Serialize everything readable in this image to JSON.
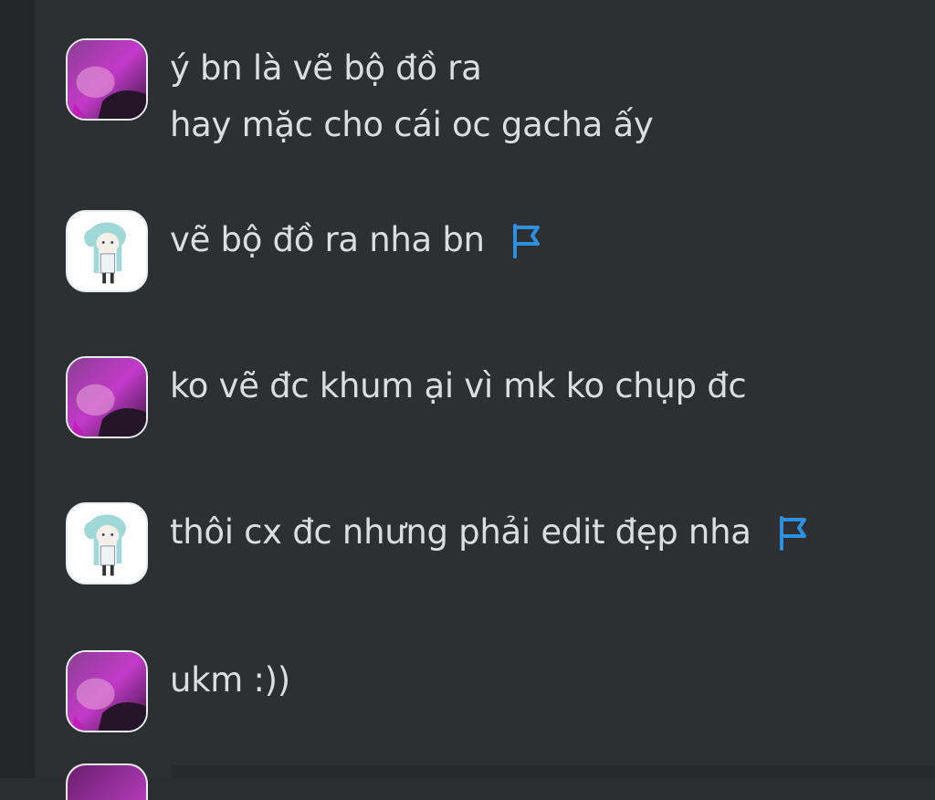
{
  "messages": [
    {
      "author": "purple",
      "lines": [
        "ý bn là vẽ bộ đồ ra",
        "hay mặc cho cái oc gacha ấy"
      ],
      "flagged": false
    },
    {
      "author": "gacha",
      "lines": [
        "vẽ bộ đồ ra nha bn"
      ],
      "flagged": true
    },
    {
      "author": "purple",
      "lines": [
        "ko vẽ đc khum ại vì mk ko chụp đc"
      ],
      "flagged": false
    },
    {
      "author": "gacha",
      "lines": [
        "thôi cx đc nhưng phải edit đẹp nha"
      ],
      "flagged": true
    },
    {
      "author": "purple",
      "lines": [
        "ukm :))"
      ],
      "flagged": false
    }
  ],
  "colors": {
    "background": "#2c3033",
    "text": "#dcdde0",
    "flag": "#2f8fe0",
    "avatar_border": "#e9ecef"
  },
  "icons": {
    "flag": "flag-icon",
    "avatar_purple": "avatar-purple",
    "avatar_gacha": "avatar-gacha"
  }
}
